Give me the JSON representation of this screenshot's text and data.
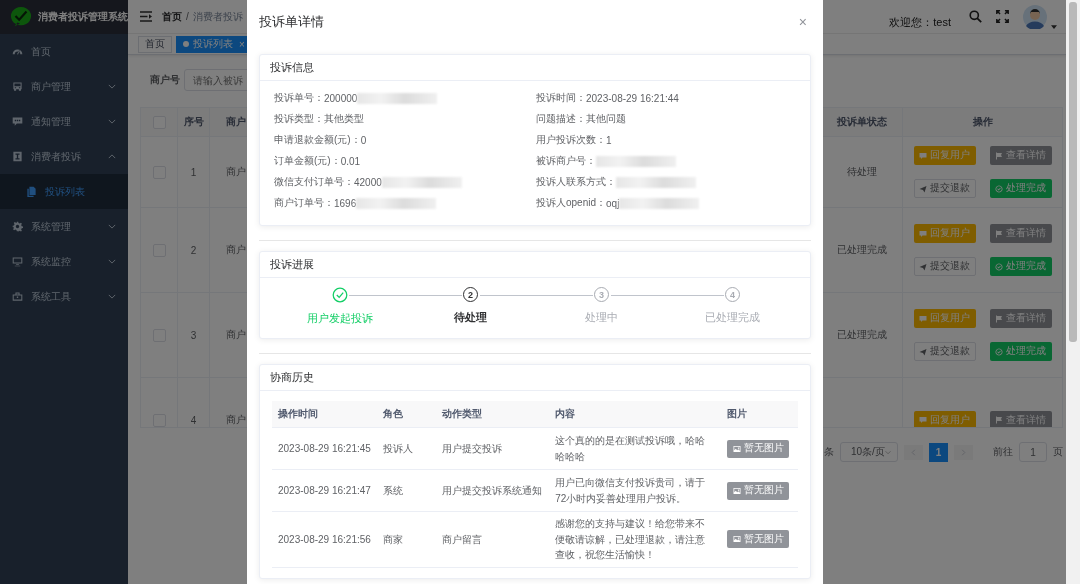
{
  "sidebar": {
    "title": "消费者投诉管理系统",
    "items": [
      {
        "label": "首页",
        "kind": "link"
      },
      {
        "label": "商户管理",
        "kind": "submenu",
        "expanded": false
      },
      {
        "label": "通知管理",
        "kind": "submenu",
        "expanded": false
      },
      {
        "label": "消费者投诉",
        "kind": "submenu",
        "expanded": true,
        "children": [
          {
            "label": "投诉列表",
            "selected": true
          }
        ]
      },
      {
        "label": "系统管理",
        "kind": "submenu",
        "expanded": false
      },
      {
        "label": "系统监控",
        "kind": "submenu",
        "expanded": false
      },
      {
        "label": "系统工具",
        "kind": "submenu",
        "expanded": false
      }
    ]
  },
  "header": {
    "breadcrumb": [
      "首页",
      "消费者投诉"
    ],
    "separator": "/",
    "welcome": "欢迎您：test"
  },
  "tags": [
    {
      "label": "首页",
      "selected": false
    },
    {
      "label": "投诉列表",
      "selected": true,
      "close": "×"
    }
  ],
  "search": {
    "label": "商户号",
    "placeholder": "请输入被诉"
  },
  "table": {
    "all_checked": false,
    "columns": [
      "序号",
      "商户",
      "投诉单状态",
      "操作"
    ],
    "rows": [
      {
        "checked": false,
        "index": "1",
        "merchant": "商户",
        "status": "待处理",
        "actions": [
          {
            "label": "回复用户",
            "kind": "reply"
          },
          {
            "label": "查看详情",
            "kind": "view"
          },
          {
            "label": "提交退款",
            "kind": "refund"
          },
          {
            "label": "处理完成",
            "kind": "done"
          }
        ]
      },
      {
        "checked": false,
        "index": "2",
        "merchant": "商户",
        "status": "已处理完成",
        "actions": [
          {
            "label": "回复用户",
            "kind": "reply"
          },
          {
            "label": "查看详情",
            "kind": "view"
          },
          {
            "label": "提交退款",
            "kind": "refund"
          },
          {
            "label": "处理完成",
            "kind": "done"
          }
        ]
      },
      {
        "checked": false,
        "index": "3",
        "merchant": "商户",
        "status": "已处理完成",
        "actions": [
          {
            "label": "回复用户",
            "kind": "reply"
          },
          {
            "label": "查看详情",
            "kind": "view"
          },
          {
            "label": "提交退款",
            "kind": "refund"
          },
          {
            "label": "处理完成",
            "kind": "done"
          }
        ]
      },
      {
        "checked": false,
        "index": "4",
        "merchant": "商户",
        "actions": [
          {
            "label": "回复用户",
            "kind": "reply"
          },
          {
            "label": "查看详情",
            "kind": "view"
          }
        ]
      }
    ]
  },
  "pagination": {
    "total_suffix": "条",
    "page_size": "10条/页",
    "pages": [
      {
        "label": "1",
        "selected": true
      }
    ],
    "goto_label": "前往",
    "goto_value": "1",
    "page_suffix": "页"
  },
  "modal": {
    "title": "投诉单详情",
    "close": "×",
    "info": {
      "title": "投诉信息",
      "fields": [
        {
          "label": "投诉单号：",
          "value": "200000",
          "redacted": true
        },
        {
          "label": "投诉时间：",
          "value": "2023-08-29 16:21:44"
        },
        {
          "label": "投诉类型：",
          "value": "其他类型"
        },
        {
          "label": "问题描述：",
          "value": "其他问题"
        },
        {
          "label": "申请退款金额(元)：",
          "value": "0"
        },
        {
          "label": "用户投诉次数：",
          "value": "1"
        },
        {
          "label": "订单金额(元)：",
          "value": "0.01"
        },
        {
          "label": "被诉商户号：",
          "redacted": true
        },
        {
          "label": "微信支付订单号：",
          "value": "42000",
          "redacted": true
        },
        {
          "label": "投诉人联系方式：",
          "redacted": true
        },
        {
          "label": "商户订单号：",
          "value": "1696",
          "redacted": true
        },
        {
          "label": "投诉人openid：",
          "value": "oqj",
          "redacted": true
        }
      ]
    },
    "progress": {
      "title": "投诉进展",
      "steps": [
        {
          "label": "用户发起投诉",
          "done": true
        },
        {
          "label": "待处理",
          "done": false,
          "current": true,
          "number": "2"
        },
        {
          "label": "处理中",
          "done": false,
          "current": false,
          "number": "3"
        },
        {
          "label": "已处理完成",
          "done": false,
          "current": false,
          "number": "4"
        }
      ]
    },
    "history": {
      "title": "协商历史",
      "columns": [
        "操作时间",
        "角色",
        "动作类型",
        "内容",
        "图片"
      ],
      "rows": [
        {
          "time": "2023-08-29 16:21:45",
          "role": "投诉人",
          "action": "用户提交投诉",
          "content": "这个真的的是在测试投诉哦，哈哈哈哈哈",
          "image": "暂无图片"
        },
        {
          "time": "2023-08-29 16:21:47",
          "role": "系统",
          "action": "用户提交投诉系统通知",
          "content": "用户已向微信支付投诉贵司，请于72小时内妥善处理用户投诉。",
          "image": "暂无图片"
        },
        {
          "time": "2023-08-29 16:21:56",
          "role": "商家",
          "action": "商户留言",
          "content": "感谢您的支持与建议！给您带来不便敬请谅解，已处理退款，请注意查收，祝您生活愉快！",
          "image": "暂无图片"
        }
      ]
    }
  }
}
